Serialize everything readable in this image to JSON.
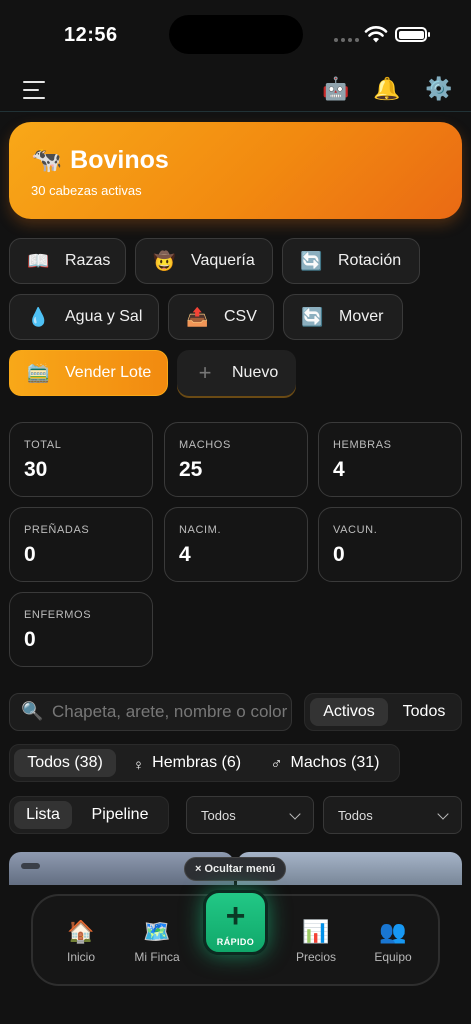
{
  "status_bar": {
    "time": "12:56"
  },
  "topbar": {
    "robot_icon": "🤖",
    "bell_icon": "🔔",
    "gear_icon": "⚙️"
  },
  "hero": {
    "icon": "🐄",
    "title": "Bovinos",
    "subtitle": "30 cabezas activas"
  },
  "actions": {
    "razas": {
      "icon": "📖",
      "label": "Razas"
    },
    "vaqueria": {
      "icon": "🤠",
      "label": "Vaquería"
    },
    "rotacion": {
      "icon": "🔄",
      "label": "Rotación"
    },
    "agua_sal": {
      "icon": "💧",
      "label": "Agua y Sal"
    },
    "csv": {
      "icon": "📤",
      "label": "CSV"
    },
    "mover": {
      "icon": "🔄",
      "label": "Mover"
    },
    "vender_lote": {
      "icon": "🚞",
      "label": "Vender Lote"
    },
    "nuevo": {
      "icon": "+",
      "label": "Nuevo"
    }
  },
  "stats": {
    "total": {
      "label": "TOTAL",
      "value": "30"
    },
    "machos": {
      "label": "MACHOS",
      "value": "25"
    },
    "hembras": {
      "label": "HEMBRAS",
      "value": "4"
    },
    "prenadas": {
      "label": "PREÑADAS",
      "value": "0"
    },
    "nacim": {
      "label": "NACIM.",
      "value": "4"
    },
    "vacun": {
      "label": "VACUN.",
      "value": "0"
    },
    "enfermos": {
      "label": "ENFERMOS",
      "value": "0"
    }
  },
  "search": {
    "icon": "🔍",
    "placeholder": "Chapeta, arete, nombre o color"
  },
  "status_filter": {
    "activos": "Activos",
    "todos": "Todos"
  },
  "sex_filter": {
    "todos": "Todos (38)",
    "hembras": "Hembras (6)",
    "machos": "Machos (31)",
    "female_icon": "♀",
    "male_icon": "♂"
  },
  "view_toggle": {
    "lista": "Lista",
    "pipeline": "Pipeline"
  },
  "dropdowns": {
    "first": "Todos",
    "second": "Todos"
  },
  "hide_menu": "× Ocultar menú",
  "bottom_nav": {
    "inicio": {
      "icon": "🏠",
      "label": "Inicio"
    },
    "mi_finca": {
      "icon": "🗺️",
      "label": "Mi Finca"
    },
    "rapido": {
      "icon": "+",
      "label": "RÁPIDO"
    },
    "precios": {
      "icon": "📊",
      "label": "Precios"
    },
    "equipo": {
      "icon": "👥",
      "label": "Equipo"
    }
  }
}
